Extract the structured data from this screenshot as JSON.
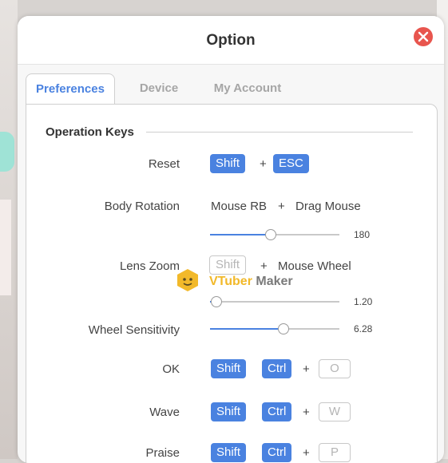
{
  "dialog": {
    "title": "Option"
  },
  "tabs": [
    {
      "label": "Preferences",
      "active": true
    },
    {
      "label": "Device",
      "active": false
    },
    {
      "label": "My Account",
      "active": false
    }
  ],
  "section": {
    "title": "Operation Keys"
  },
  "settings": {
    "reset": {
      "label": "Reset",
      "key1": "Shift",
      "plus": "+",
      "key2": "ESC"
    },
    "body_rotation": {
      "label": "Body Rotation",
      "input1": "Mouse RB",
      "plus": "+",
      "input2": "Drag Mouse",
      "slider_value": "180",
      "slider_level": 0.47
    },
    "lens_zoom": {
      "label": "Lens Zoom",
      "key1": "Shift",
      "plus": "+",
      "input2": "Mouse Wheel",
      "slider_value": "1.20",
      "slider_level": 0.05
    },
    "wheel_sensitivity": {
      "label": "Wheel Sensitivity",
      "slider_value": "6.28",
      "slider_level": 0.57
    },
    "ok": {
      "label": "OK",
      "key1": "Shift",
      "key2": "Ctrl",
      "plus": "+",
      "key3": "O"
    },
    "wave": {
      "label": "Wave",
      "key1": "Shift",
      "key2": "Ctrl",
      "plus": "+",
      "key3": "W"
    },
    "praise": {
      "label": "Praise",
      "key1": "Shift",
      "key2": "Ctrl",
      "plus": "+",
      "key3": "P"
    }
  },
  "watermark": {
    "part1": "VTuber",
    "part2": " Maker"
  },
  "colors": {
    "accent": "#4a82e0",
    "close": "#e8554e",
    "watermark_yellow": "#f2b92a"
  },
  "icons": {
    "close": "close-icon",
    "watermark": "vtuber-maker-logo-icon"
  }
}
